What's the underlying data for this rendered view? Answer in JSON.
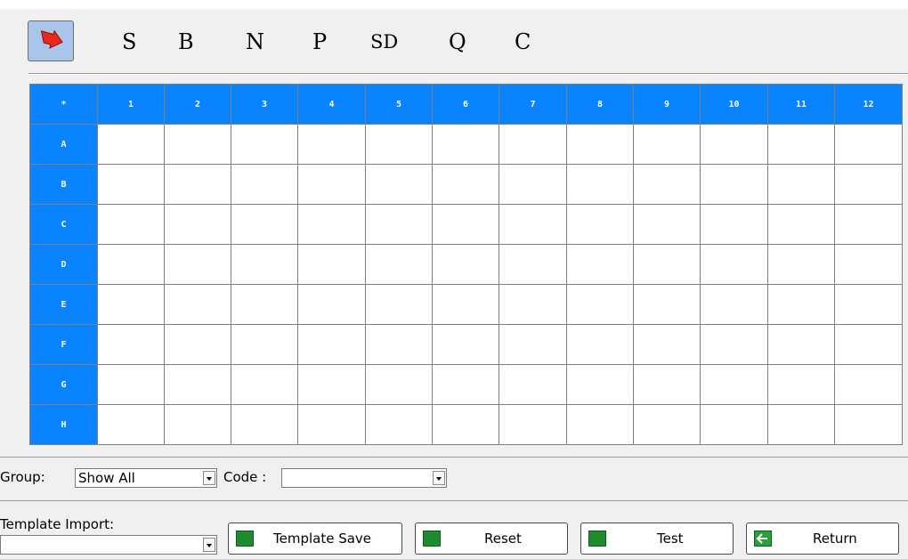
{
  "toolbar": {
    "tools": [
      "S",
      "B",
      "N",
      "P",
      "SD",
      "Q",
      "C"
    ]
  },
  "plate": {
    "corner": "*",
    "columns": [
      "1",
      "2",
      "3",
      "4",
      "5",
      "6",
      "7",
      "8",
      "9",
      "10",
      "11",
      "12"
    ],
    "rows": [
      "A",
      "B",
      "C",
      "D",
      "E",
      "F",
      "G",
      "H"
    ]
  },
  "filters": {
    "group_label": "Group:",
    "group_value": "Show All",
    "code_label": "Code :",
    "code_value": ""
  },
  "template": {
    "import_label": "Template Import:",
    "import_value": ""
  },
  "buttons": {
    "template_save": "Template Save",
    "reset": "Reset",
    "test": "Test",
    "return": "Return"
  },
  "colors": {
    "header_blue": "#0a83ff",
    "button_green": "#1f8a2e",
    "selected_tool_bg": "#a9c6ea"
  },
  "icons": {
    "select_tool": "red-arrow-icon",
    "button_icon": "green-square-icon",
    "return_icon": "back-arrow-icon"
  }
}
